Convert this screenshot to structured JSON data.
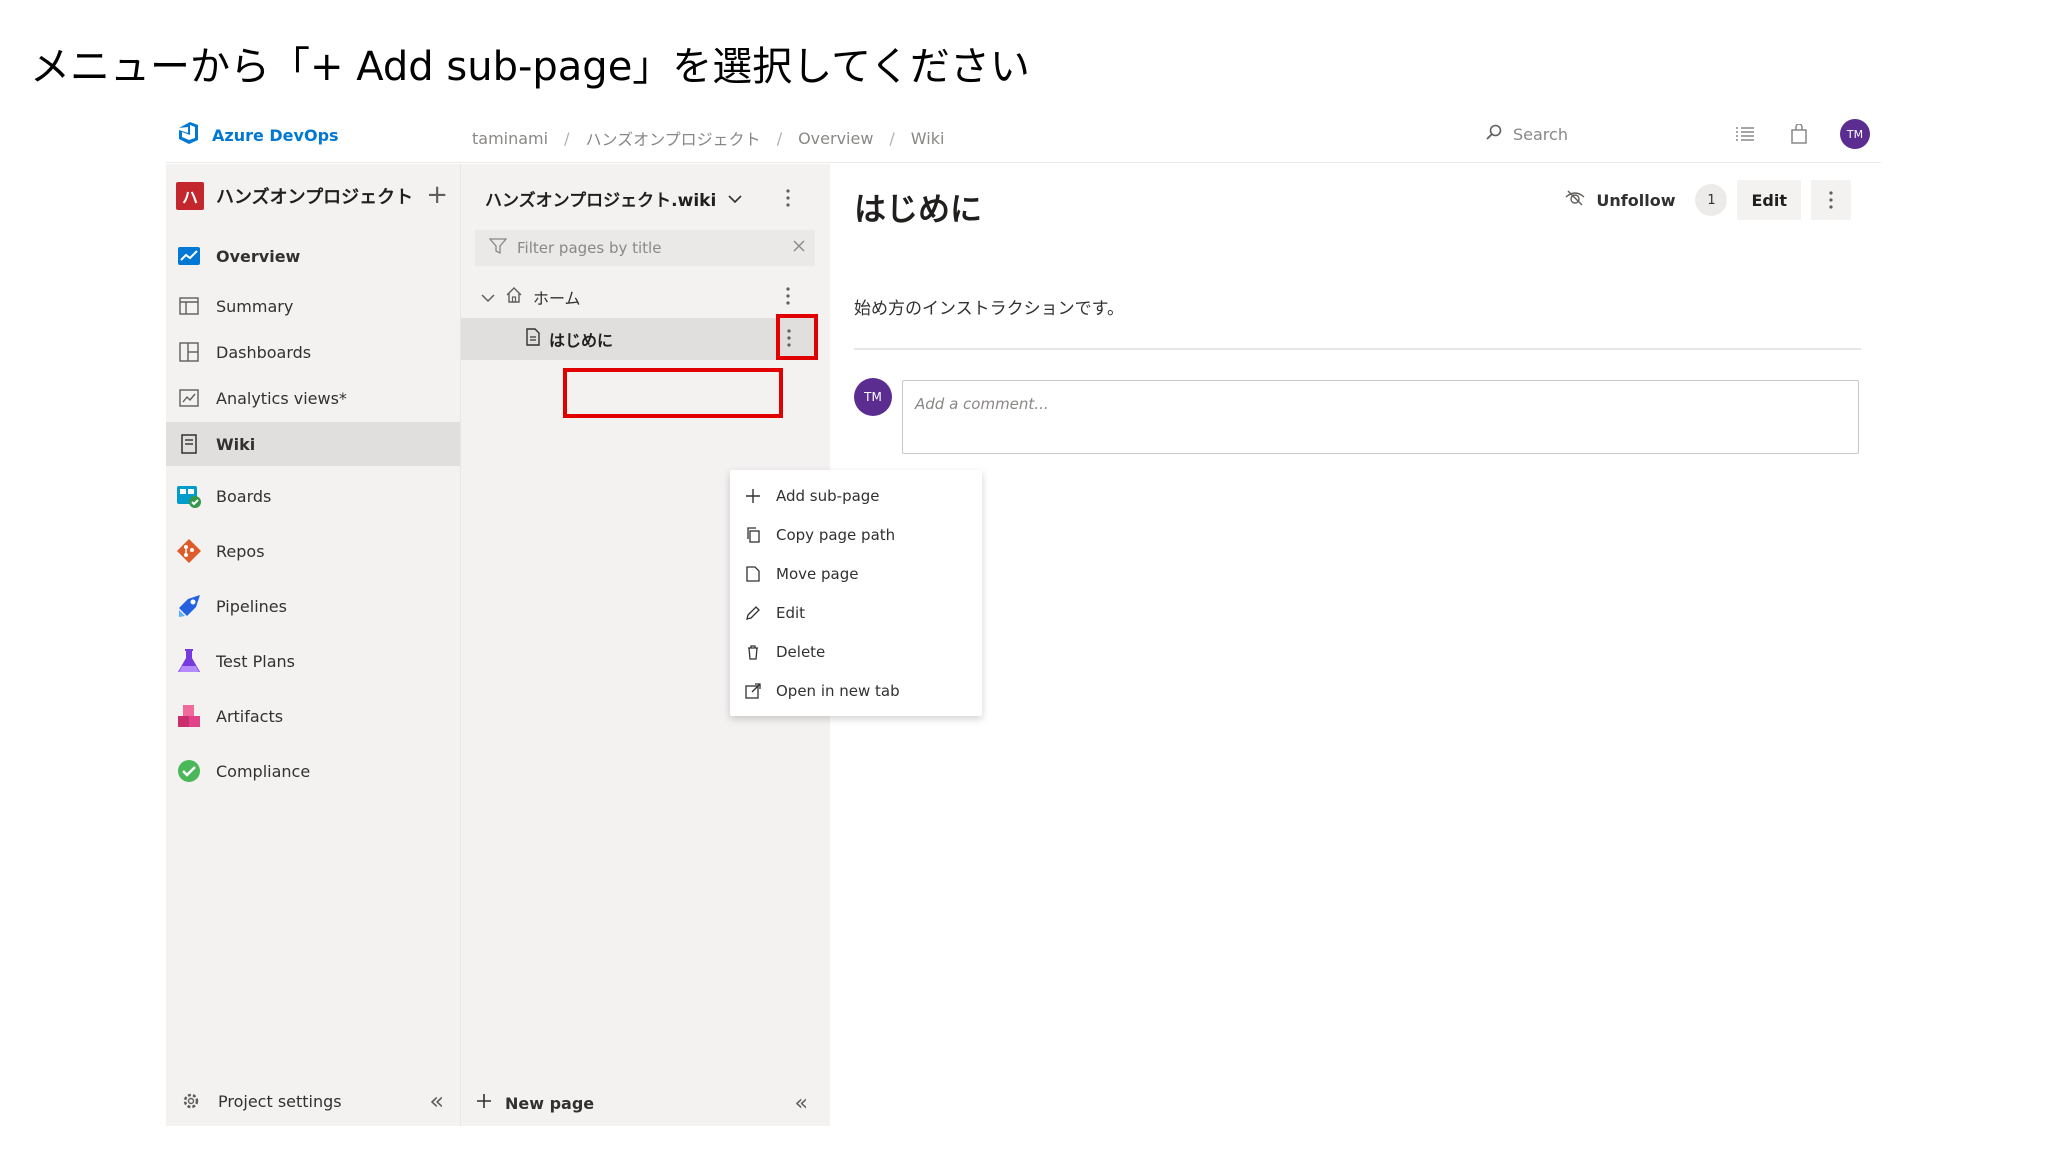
{
  "instruction": "メニューから「+ Add sub-page」を選択してください",
  "topbar": {
    "brand": "Azure DevOps",
    "breadcrumb": [
      "taminami",
      "ハンズオンプロジェクト",
      "Overview",
      "Wiki"
    ],
    "search_placeholder": "Search",
    "avatar_initials": "TM"
  },
  "leftnav": {
    "project_initial": "ハ",
    "project_name": "ハンズオンプロジェクト",
    "items": [
      {
        "label": "Overview",
        "icon": "overview-icon"
      },
      {
        "label": "Summary",
        "icon": "summary-icon"
      },
      {
        "label": "Dashboards",
        "icon": "dashboards-icon"
      },
      {
        "label": "Analytics views*",
        "icon": "analytics-icon"
      },
      {
        "label": "Wiki",
        "icon": "wiki-icon"
      },
      {
        "label": "Boards",
        "icon": "boards-icon"
      },
      {
        "label": "Repos",
        "icon": "repos-icon"
      },
      {
        "label": "Pipelines",
        "icon": "pipelines-icon"
      },
      {
        "label": "Test Plans",
        "icon": "test-plans-icon"
      },
      {
        "label": "Artifacts",
        "icon": "artifacts-icon"
      },
      {
        "label": "Compliance",
        "icon": "compliance-icon"
      }
    ],
    "selected": "Wiki",
    "footer": "Project settings"
  },
  "tree": {
    "wiki_name": "ハンズオンプロジェクト.wiki",
    "filter_placeholder": "Filter pages by title",
    "home": "ホーム",
    "page": "はじめに",
    "new_page": "New page"
  },
  "context_menu": {
    "items": [
      {
        "label": "Add sub-page",
        "icon": "plus-icon"
      },
      {
        "label": "Copy page path",
        "icon": "copy-icon"
      },
      {
        "label": "Move page",
        "icon": "move-icon"
      },
      {
        "label": "Edit",
        "icon": "pencil-icon"
      },
      {
        "label": "Delete",
        "icon": "trash-icon"
      },
      {
        "label": "Open in new tab",
        "icon": "open-new-tab-icon"
      }
    ]
  },
  "content": {
    "title": "はじめに",
    "unfollow": "Unfollow",
    "follower_count": "1",
    "edit": "Edit",
    "body": "始め方のインストラクションです。",
    "comment_placeholder": "Add a comment...",
    "avatar_initials": "TM"
  },
  "colors": {
    "brand_blue": "#0078d4",
    "highlight_red": "#e00000",
    "avatar_purple": "#5c2d91",
    "project_red": "#c4262e"
  }
}
